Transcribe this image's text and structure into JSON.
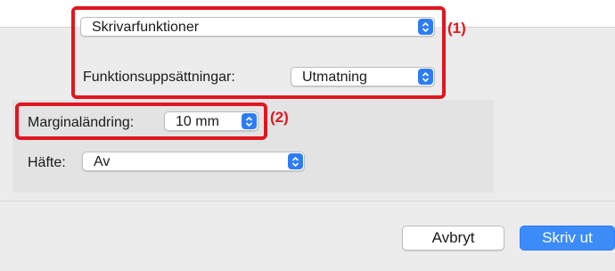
{
  "printer_features": {
    "selected": "Skrivarfunktioner",
    "feature_sets_label": "Funktionsuppsättningar:",
    "feature_sets_value": "Utmatning"
  },
  "options": {
    "margin_label": "Marginaländring:",
    "margin_value": "10 mm",
    "booklet_label": "Häfte:",
    "booklet_value": "Av"
  },
  "callouts": {
    "one": "(1)",
    "two": "(2)"
  },
  "buttons": {
    "cancel": "Avbryt",
    "print": "Skriv ut"
  },
  "colors": {
    "highlight": "#e0161f",
    "accent": "#2d7cf6"
  },
  "icons": {
    "stepper": "up-down-chevron-icon"
  }
}
